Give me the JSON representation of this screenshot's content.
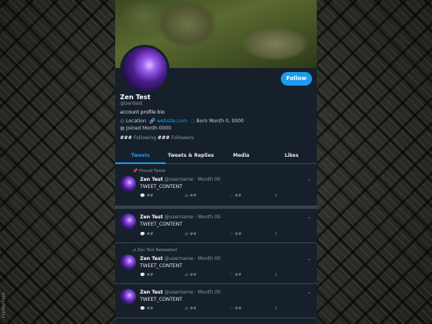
{
  "profile": {
    "name": "Zen Test",
    "handle": "@zentest",
    "bio": "account profile bio",
    "location": "Location",
    "website": "website.com",
    "born": "Born Month 0, 0000",
    "joined": "Joined Month 0000",
    "following_count": "###",
    "following_label": "Following",
    "followers_count": "###",
    "followers_label": "Followers",
    "follow_button": "Follow"
  },
  "tabs": [
    {
      "label": "Tweets"
    },
    {
      "label": "Tweets & Replies"
    },
    {
      "label": "Media"
    },
    {
      "label": "Likes"
    }
  ],
  "tweets": [
    {
      "note": "Pinned Tweet",
      "name": "Zen Test",
      "handle": "@username",
      "date": "· Month 00",
      "content": "TWEET_CONTENT",
      "replies": "##",
      "retweets": "##",
      "likes": "##"
    },
    {
      "note": "",
      "name": "Zen Test",
      "handle": "@username",
      "date": "· Month 00",
      "content": "TWEET_CONTENT",
      "replies": "##",
      "retweets": "##",
      "likes": "##"
    },
    {
      "note": "Zen Test Retweeted",
      "name": "Zen Test",
      "handle": "@username",
      "date": "· Month 00",
      "content": "TWEET_CONTENT",
      "replies": "##",
      "retweets": "##",
      "likes": "##"
    },
    {
      "note": "",
      "name": "Zen Test",
      "handle": "@username",
      "date": "· Month 00",
      "content": "TWEET_CONTENT",
      "replies": "##",
      "retweets": "##",
      "likes": "##"
    }
  ],
  "watermark": "FEEDBURNER",
  "colors": {
    "accent": "#1d9bf0",
    "background": "#15202b",
    "border": "#38444d"
  }
}
